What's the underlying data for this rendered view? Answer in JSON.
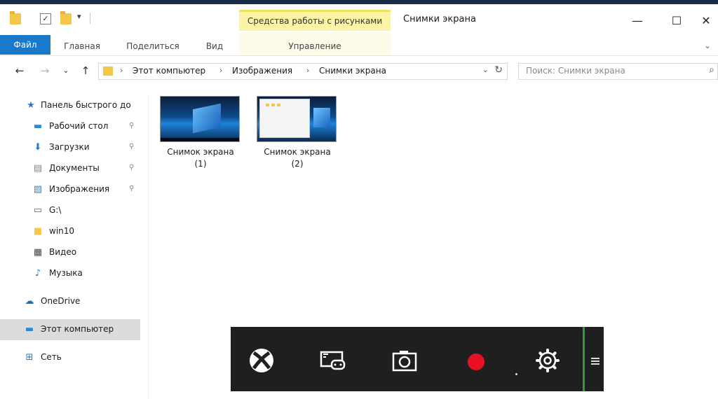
{
  "title_bar": {
    "context_tab_label": "Средства работы с рисунками",
    "window_title": "Снимки экрана",
    "qat_check": "✓",
    "qat_dropdown": "▾",
    "minimize_glyph": "—",
    "maximize_glyph": "☐",
    "close_glyph": "✕"
  },
  "ribbon": {
    "tabs": [
      "Файл",
      "Главная",
      "Поделиться",
      "Вид",
      "Управление"
    ],
    "expand_glyph": "⌄"
  },
  "address_bar": {
    "back_glyph": "←",
    "forward_glyph": "→",
    "recent_glyph": "⌄",
    "up_glyph": "↑",
    "separator": "›",
    "breadcrumbs": [
      "Этот компьютер",
      "Изображения",
      "Снимки экрана"
    ],
    "dropdown_glyph": "⌄",
    "refresh_glyph": "↻",
    "search_placeholder": "Поиск: Снимки экрана",
    "search_glyph": "⌕"
  },
  "navigation_pane": {
    "items": [
      {
        "label": "Панель быстрого до",
        "icon": "star-icon",
        "glyph": "★",
        "color": "#2a78c6"
      },
      {
        "label": "Рабочий стол",
        "icon": "desktop-icon",
        "glyph": "▬",
        "color": "#2a8ad6",
        "pinned": "⚲"
      },
      {
        "label": "Загрузки",
        "icon": "download-icon",
        "glyph": "⬇",
        "color": "#2a78c6",
        "pinned": "⚲"
      },
      {
        "label": "Документы",
        "icon": "documents-icon",
        "glyph": "▤",
        "color": "#7a8a99",
        "pinned": "⚲"
      },
      {
        "label": "Изображения",
        "icon": "pictures-icon",
        "glyph": "▧",
        "color": "#4a7fb0",
        "pinned": "⚲"
      },
      {
        "label": "G:\\",
        "icon": "drive-icon",
        "glyph": "▭",
        "color": "#666666"
      },
      {
        "label": "win10",
        "icon": "folder-icon",
        "glyph": "■",
        "color": "#f5c749"
      },
      {
        "label": "Видео",
        "icon": "video-icon",
        "glyph": "▦",
        "color": "#444444"
      },
      {
        "label": "Музыка",
        "icon": "music-icon",
        "glyph": "♪",
        "color": "#2a78c6"
      },
      {
        "label": "OneDrive",
        "icon": "onedrive-icon",
        "glyph": "☁",
        "color": "#1e6fc0"
      },
      {
        "label": "Этот компьютер",
        "icon": "this-pc-icon",
        "glyph": "▬",
        "color": "#2a8ad6",
        "selected": true
      },
      {
        "label": "Сеть",
        "icon": "network-icon",
        "glyph": "⊞",
        "color": "#2a78c6"
      }
    ]
  },
  "files": [
    {
      "name_line1": "Снимок экрана",
      "name_line2": "(1)"
    },
    {
      "name_line1": "Снимок экрана",
      "name_line2": "(2)"
    }
  ],
  "game_bar": {
    "buttons": [
      "xbox-icon",
      "broadcast-icon",
      "screenshot-icon",
      "record-icon",
      "settings-icon"
    ],
    "record_color": "#e81123",
    "divider_color": "#2e9b3c"
  }
}
